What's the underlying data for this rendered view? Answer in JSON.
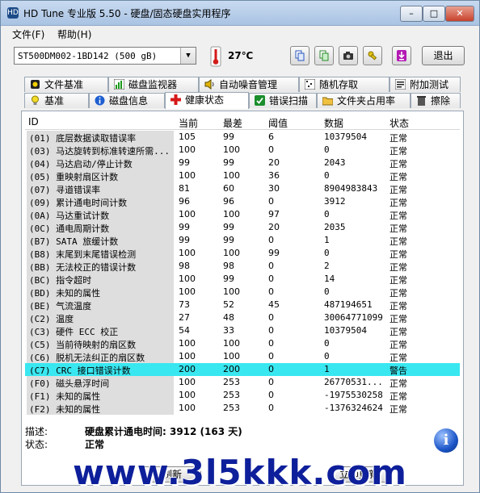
{
  "window": {
    "title": "HD Tune 专业版 5.50 - 硬盘/固态硬盘实用程序",
    "min_label": "–",
    "max_label": "□",
    "close_label": "✕"
  },
  "menu": {
    "items": [
      "文件(F)",
      "帮助(H)"
    ]
  },
  "toolbar": {
    "drive": "ST500DM002-1BD142 (500 gB)",
    "temperature": "27℃",
    "exit_label": "退出",
    "buttons": [
      "copy-text-icon",
      "copy-image-icon",
      "camera-icon",
      "options-icon",
      "download-icon"
    ]
  },
  "tabs": {
    "row1": [
      "文件基准",
      "磁盘监视器",
      "自动噪音管理",
      "随机存取",
      "附加测试"
    ],
    "row2": [
      "基准",
      "磁盘信息",
      "健康状态",
      "错误扫描",
      "文件夹占用率",
      "擦除"
    ],
    "active": "健康状态"
  },
  "table": {
    "columns": [
      "ID",
      "当前",
      "最差",
      "阈值",
      "数据",
      "状态"
    ],
    "rows": [
      {
        "id": "(01) 底层数据读取错误率",
        "cur": "105",
        "worst": "99",
        "thr": "6",
        "data": "10379504",
        "status": "正常"
      },
      {
        "id": "(03) 马达旋转到标准转速所需...",
        "cur": "100",
        "worst": "100",
        "thr": "0",
        "data": "0",
        "status": "正常"
      },
      {
        "id": "(04) 马达启动/停止计数",
        "cur": "99",
        "worst": "99",
        "thr": "20",
        "data": "2043",
        "status": "正常"
      },
      {
        "id": "(05) 重映射扇区计数",
        "cur": "100",
        "worst": "100",
        "thr": "36",
        "data": "0",
        "status": "正常"
      },
      {
        "id": "(07) 寻道错误率",
        "cur": "81",
        "worst": "60",
        "thr": "30",
        "data": "8904983843",
        "status": "正常"
      },
      {
        "id": "(09) 累计通电时间计数",
        "cur": "96",
        "worst": "96",
        "thr": "0",
        "data": "3912",
        "status": "正常"
      },
      {
        "id": "(0A) 马达重试计数",
        "cur": "100",
        "worst": "100",
        "thr": "97",
        "data": "0",
        "status": "正常"
      },
      {
        "id": "(0C) 通电周期计数",
        "cur": "99",
        "worst": "99",
        "thr": "20",
        "data": "2035",
        "status": "正常"
      },
      {
        "id": "(B7) SATA 旅缓计数",
        "cur": "99",
        "worst": "99",
        "thr": "0",
        "data": "1",
        "status": "正常"
      },
      {
        "id": "(B8) 末尾到末尾错误检测",
        "cur": "100",
        "worst": "100",
        "thr": "99",
        "data": "0",
        "status": "正常"
      },
      {
        "id": "(BB) 无法校正的错误计数",
        "cur": "98",
        "worst": "98",
        "thr": "0",
        "data": "2",
        "status": "正常"
      },
      {
        "id": "(BC) 指令超时",
        "cur": "100",
        "worst": "99",
        "thr": "0",
        "data": "14",
        "status": "正常"
      },
      {
        "id": "(BD) 未知的属性",
        "cur": "100",
        "worst": "100",
        "thr": "0",
        "data": "0",
        "status": "正常"
      },
      {
        "id": "(BE) 气流温度",
        "cur": "73",
        "worst": "52",
        "thr": "45",
        "data": "487194651",
        "status": "正常"
      },
      {
        "id": "(C2) 温度",
        "cur": "27",
        "worst": "48",
        "thr": "0",
        "data": "30064771099",
        "status": "正常"
      },
      {
        "id": "(C3) 硬件 ECC 校正",
        "cur": "54",
        "worst": "33",
        "thr": "0",
        "data": "10379504",
        "status": "正常"
      },
      {
        "id": "(C5) 当前待映射的扇区数",
        "cur": "100",
        "worst": "100",
        "thr": "0",
        "data": "0",
        "status": "正常"
      },
      {
        "id": "(C6) 脱机无法纠正的扇区数",
        "cur": "100",
        "worst": "100",
        "thr": "0",
        "data": "0",
        "status": "正常"
      },
      {
        "id": "(C7) CRC 接口错误计数",
        "cur": "200",
        "worst": "200",
        "thr": "0",
        "data": "1",
        "status": "警告"
      },
      {
        "id": "(F0) 磁头悬浮时间",
        "cur": "100",
        "worst": "253",
        "thr": "0",
        "data": "26770531...",
        "status": "正常"
      },
      {
        "id": "(F1) 未知的属性",
        "cur": "100",
        "worst": "253",
        "thr": "0",
        "data": "-1975530258",
        "status": "正常"
      },
      {
        "id": "(F2) 未知的属性",
        "cur": "100",
        "worst": "253",
        "thr": "0",
        "data": "-1376324624",
        "status": "正常"
      }
    ],
    "selected_index": 18
  },
  "details": {
    "desc_label": "描述:",
    "desc_value": "硬盘累计通电时间: 3912 (163 天)",
    "status_label": "状态:",
    "status_value": "正常"
  },
  "bottom": {
    "refresh_label": "刷新",
    "update_label": "立即更新"
  },
  "watermark": {
    "text": "www.3l5kkk.com"
  },
  "colors": {
    "selected_row": "#39e7f0",
    "id_column_bg": "#dedede"
  }
}
